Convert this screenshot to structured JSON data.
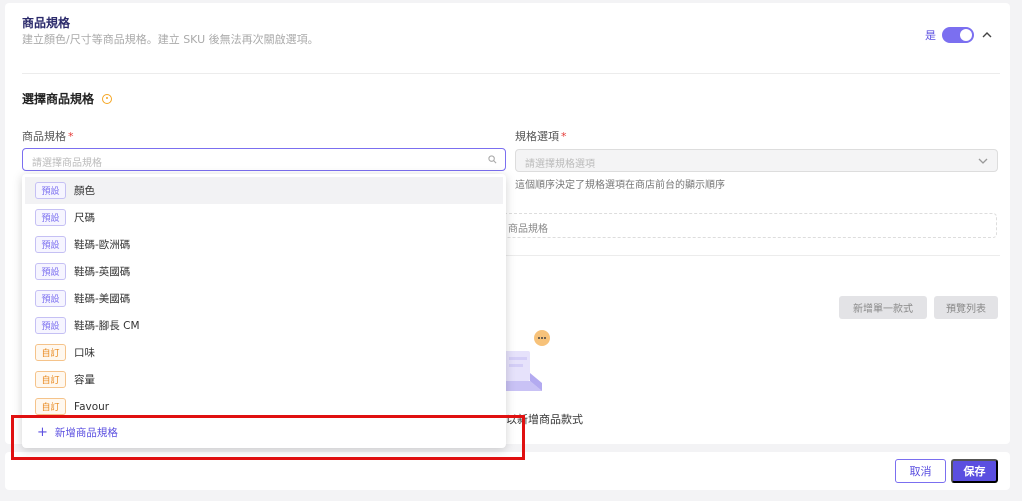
{
  "section": {
    "title": "商品規格",
    "description": "建立顏色/尺寸等商品規格。建立 SKU 後無法再次關啟選項。",
    "toggle_label": "是"
  },
  "spec_selection": {
    "title": "選擇商品規格",
    "spec_field": {
      "label": "商品規格",
      "required_mark": "*",
      "placeholder": "請選擇商品規格"
    },
    "option_field": {
      "label": "規格選項",
      "required_mark": "*",
      "placeholder": "請選擇規格選項",
      "hint": "這個順序決定了規格選項在商店前台的顯示順序"
    },
    "add_spec_partial": "商品規格"
  },
  "variants": {
    "add_single_button": "新增單一款式",
    "preview_list_button": "預覽列表",
    "empty_text": "以新增商品款式"
  },
  "dropdown": {
    "items": [
      {
        "tag": "預設",
        "label": "顏色",
        "type": "preset"
      },
      {
        "tag": "預設",
        "label": "尺碼",
        "type": "preset"
      },
      {
        "tag": "預設",
        "label": "鞋碼-歐洲碼",
        "type": "preset"
      },
      {
        "tag": "預設",
        "label": "鞋碼-英國碼",
        "type": "preset"
      },
      {
        "tag": "預設",
        "label": "鞋碼-美國碼",
        "type": "preset"
      },
      {
        "tag": "預設",
        "label": "鞋碼-腳長 CM",
        "type": "preset"
      },
      {
        "tag": "自訂",
        "label": "口味",
        "type": "custom"
      },
      {
        "tag": "自訂",
        "label": "容量",
        "type": "custom"
      },
      {
        "tag": "自訂",
        "label": "Favour",
        "type": "custom"
      }
    ],
    "add_label": "新增商品規格",
    "add_icon": "plus-icon"
  },
  "footer": {
    "cancel_label": "取消",
    "save_label": "保存"
  },
  "colors": {
    "accent": "#5b4fe0",
    "toggle_on": "#7b6ff0",
    "preset_tag": "#7b6ff0",
    "custom_tag": "#e88a20",
    "highlight_box": "#e01010"
  }
}
